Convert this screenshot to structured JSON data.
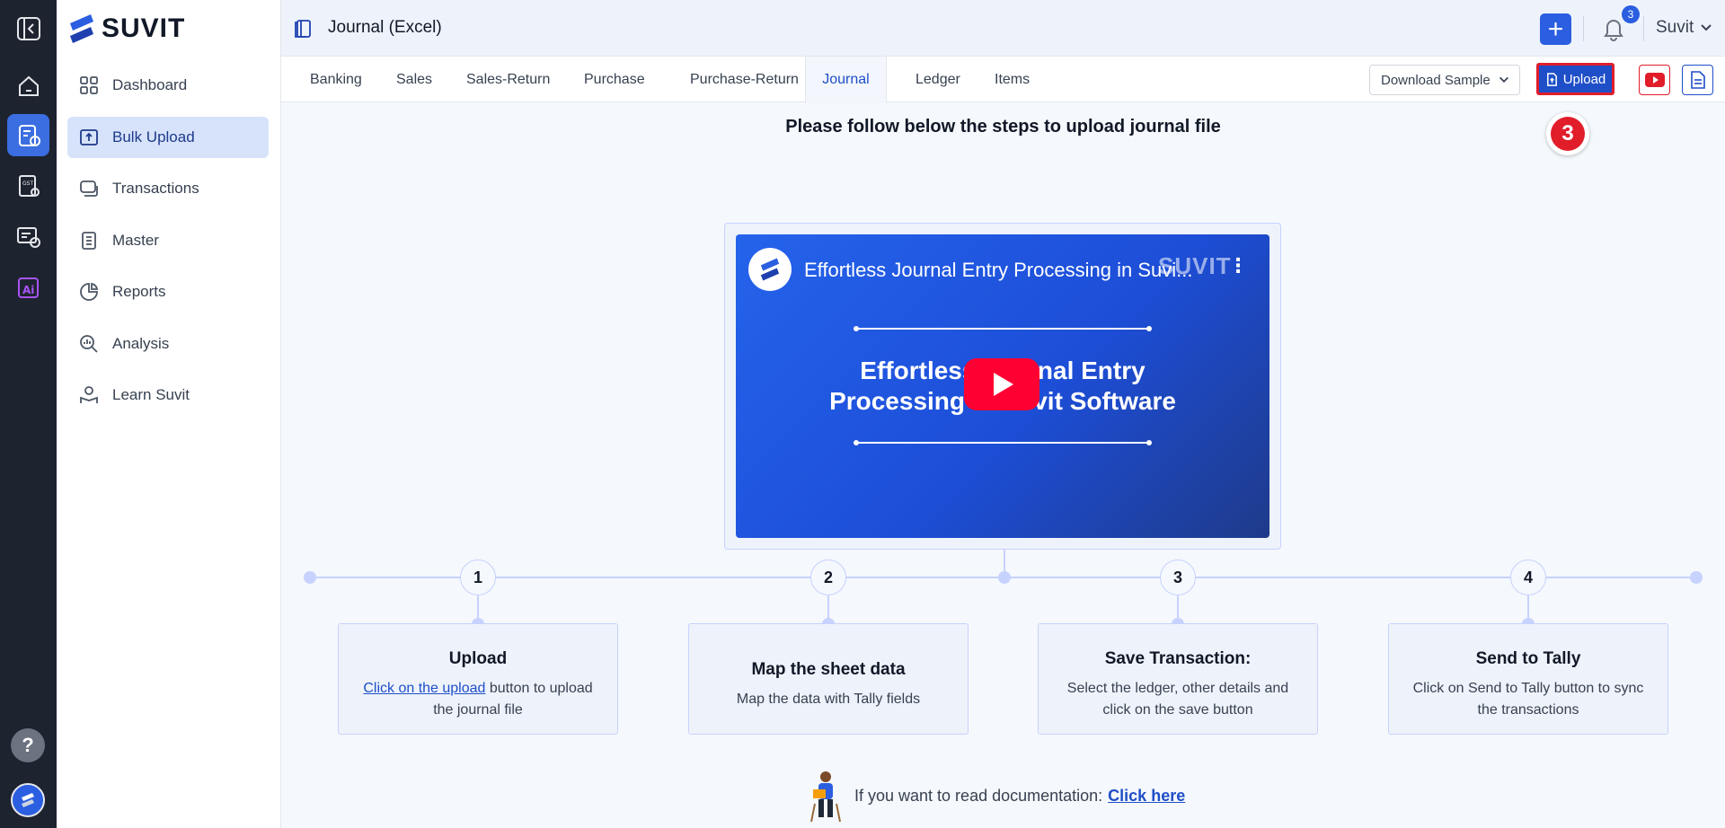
{
  "brand": {
    "name": "SUVIT"
  },
  "rail": {
    "icons": [
      "collapse-icon",
      "home-icon",
      "bulk-upload-icon",
      "gst-icon",
      "chat-clock-icon",
      "ai-icon"
    ],
    "help": "?"
  },
  "sidebar": {
    "items": [
      {
        "label": "Dashboard",
        "icon": "grid-icon",
        "active": false
      },
      {
        "label": "Bulk Upload",
        "icon": "upload-icon",
        "active": true
      },
      {
        "label": "Transactions",
        "icon": "stack-icon",
        "active": false
      },
      {
        "label": "Master",
        "icon": "list-icon",
        "active": false
      },
      {
        "label": "Reports",
        "icon": "pie-icon",
        "active": false
      },
      {
        "label": "Analysis",
        "icon": "magnify-chart-icon",
        "active": false
      },
      {
        "label": "Learn Suvit",
        "icon": "learn-icon",
        "active": false
      }
    ]
  },
  "header": {
    "title": "Journal (Excel)",
    "plus": "+",
    "notification_count": "3",
    "user": "Suvit"
  },
  "tabs": [
    {
      "label": "Banking",
      "active": false
    },
    {
      "label": "Sales",
      "active": false
    },
    {
      "label": "Sales-Return",
      "active": false
    },
    {
      "label": "Purchase",
      "active": false
    },
    {
      "label": "Purchase-Return",
      "active": false
    },
    {
      "label": "Journal",
      "active": true
    },
    {
      "label": "Ledger",
      "active": false
    },
    {
      "label": "Items",
      "active": false
    }
  ],
  "toolbar": {
    "download_sample": "Download Sample",
    "upload": "Upload",
    "step_marker": "3"
  },
  "main": {
    "heading": "Please follow below the steps to upload journal file",
    "video": {
      "title": "Effortless Journal Entry Processing in Suvi...",
      "watermark": "SUVIT",
      "headline_line1": "Effortless Journal Entry",
      "headline_line2": "Processing in Suvit Software"
    },
    "steps": [
      {
        "number": "1",
        "title": "Upload",
        "link": "Click on the upload",
        "desc": " button to upload the journal file"
      },
      {
        "number": "2",
        "title": "Map the sheet data",
        "desc": "Map the data with Tally fields"
      },
      {
        "number": "3",
        "title": "Save Transaction:",
        "desc": "Select the ledger, other details and click on the save button"
      },
      {
        "number": "4",
        "title": "Send to Tally",
        "desc": "Click on Send to Tally button to sync the transactions"
      }
    ],
    "documentation": {
      "text": "If you want to read documentation:",
      "link": "Click here"
    }
  }
}
